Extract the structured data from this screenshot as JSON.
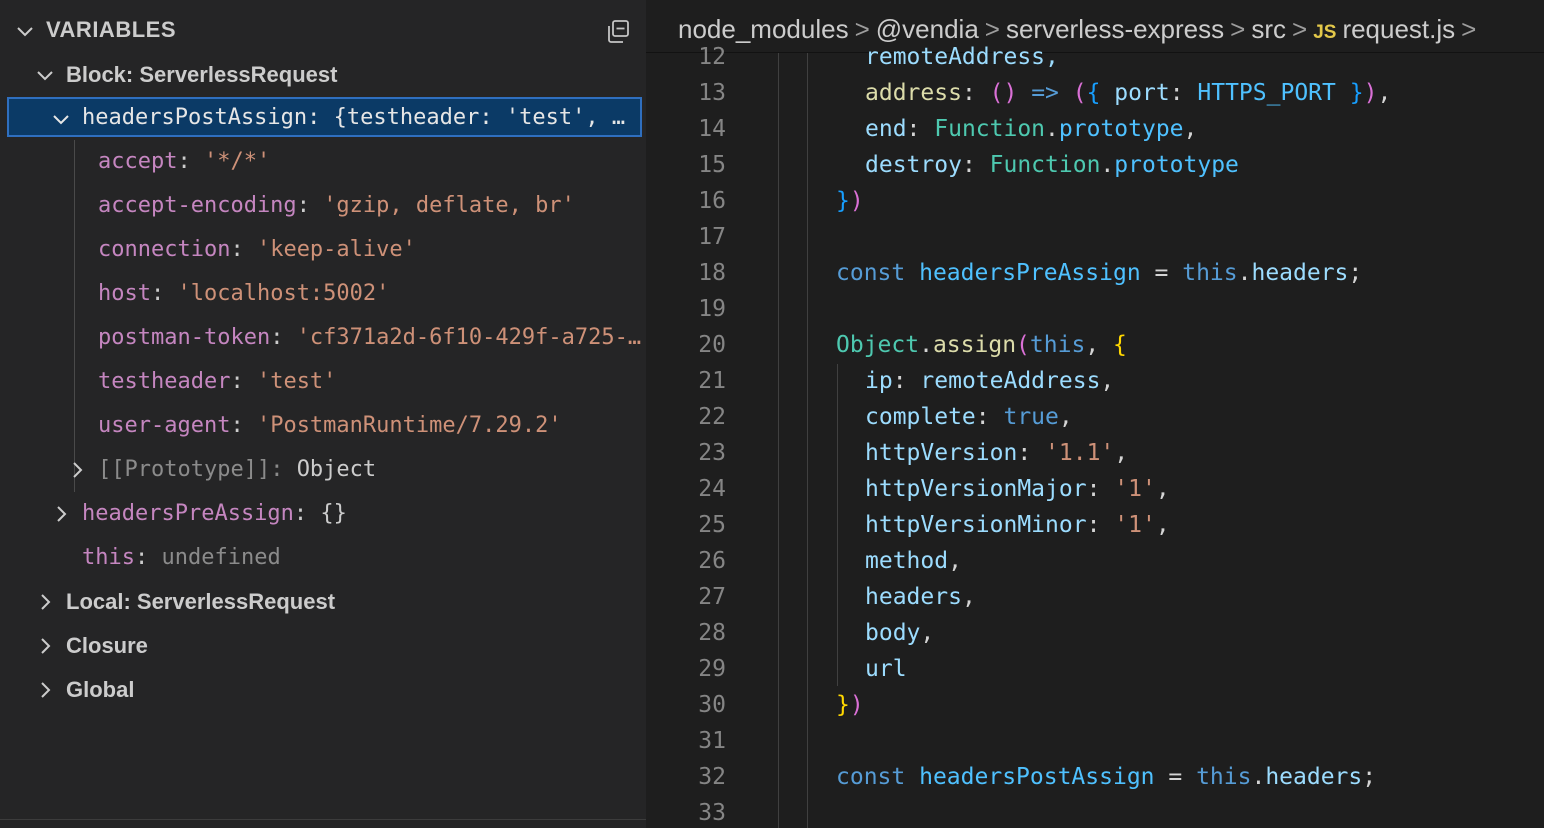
{
  "variables_panel": {
    "header": "VARIABLES",
    "scopes": [
      {
        "label": "Block: ServerlessRequest",
        "expanded": true
      },
      {
        "label": "Local: ServerlessRequest",
        "expanded": false
      },
      {
        "label": "Closure",
        "expanded": false
      },
      {
        "label": "Global",
        "expanded": false
      }
    ],
    "selected_var": {
      "name": "headersPostAssign",
      "value": "{testheader: 'test', …"
    },
    "children": [
      {
        "key": "accept",
        "value": "'*/*'"
      },
      {
        "key": "accept-encoding",
        "value": "'gzip, deflate, br'"
      },
      {
        "key": "connection",
        "value": "'keep-alive'"
      },
      {
        "key": "host",
        "value": "'localhost:5002'"
      },
      {
        "key": "postman-token",
        "value": "'cf371a2d-6f10-429f-a725-…"
      },
      {
        "key": "testheader",
        "value": "'test'"
      },
      {
        "key": "user-agent",
        "value": "'PostmanRuntime/7.29.2'"
      }
    ],
    "prototype": {
      "key": "[[Prototype]]",
      "value": "Object"
    },
    "pre_assign": {
      "name": "headersPreAssign",
      "value": "{}"
    },
    "this_var": {
      "name": "this",
      "value": "undefined"
    }
  },
  "breadcrumb": {
    "items": [
      "node_modules",
      "@vendia",
      "serverless-express",
      "src"
    ],
    "file_icon": "JS",
    "file": "request.js",
    "trailing": ">"
  },
  "editor": {
    "line_numbers": [
      "12",
      "13",
      "14",
      "15",
      "16",
      "17",
      "18",
      "19",
      "20",
      "21",
      "22",
      "23",
      "24",
      "25",
      "26",
      "27",
      "28",
      "29",
      "30",
      "31",
      "32",
      "33"
    ],
    "code": {
      "l12": "remoteAddress,",
      "l13_prop": "address",
      "l13_port": "port",
      "l13_const": "HTTPS_PORT",
      "l14_prop": "end",
      "l14_cls": "Function",
      "l14_proto": "prototype",
      "l15_prop": "destroy",
      "l15_cls": "Function",
      "l15_proto": "prototype",
      "l18_kw": "const",
      "l18_var": "headersPreAssign",
      "l18_this": "this",
      "l18_prop": "headers",
      "l20_cls": "Object",
      "l20_fn": "assign",
      "l20_this": "this",
      "l21_prop": "ip",
      "l21_val": "remoteAddress",
      "l22_prop": "complete",
      "l22_val": "true",
      "l23_prop": "httpVersion",
      "l23_val": "'1.1'",
      "l24_prop": "httpVersionMajor",
      "l24_val": "'1'",
      "l25_prop": "httpVersionMinor",
      "l25_val": "'1'",
      "l26": "method",
      "l27": "headers",
      "l28": "body",
      "l29": "url",
      "l32_kw": "const",
      "l32_var": "headersPostAssign",
      "l32_this": "this",
      "l32_prop": "headers"
    }
  }
}
